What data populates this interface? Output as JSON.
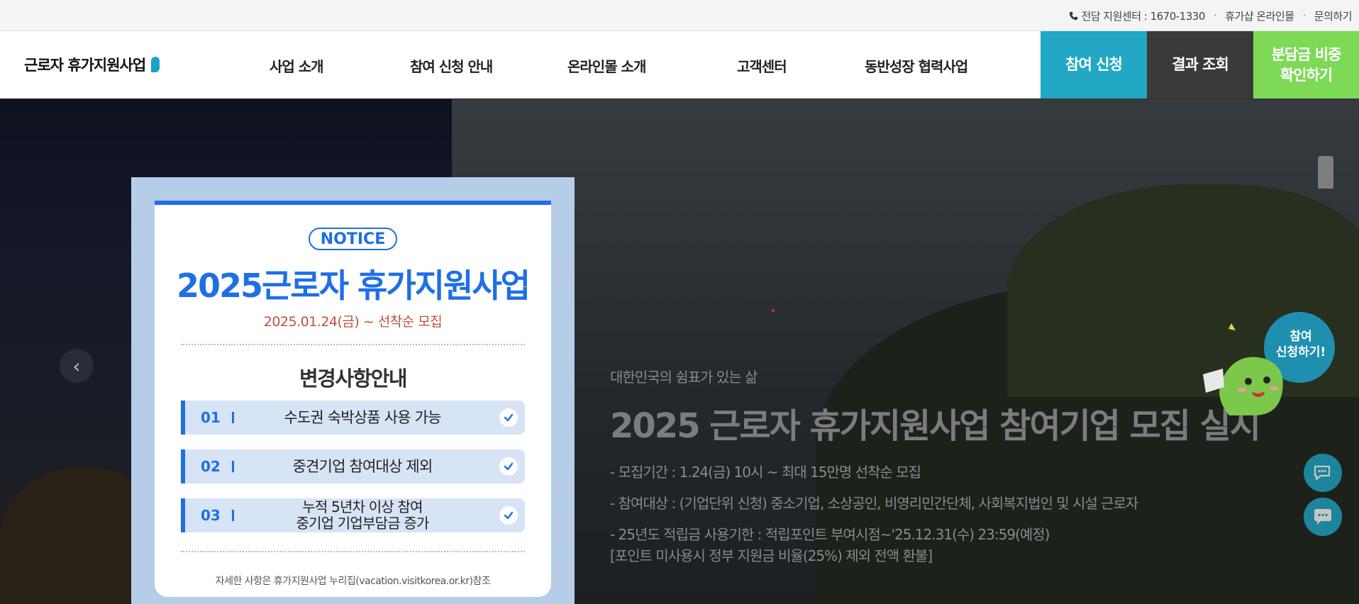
{
  "topbar": {
    "phone": "전담 지원센터 : 1670-1330",
    "mall": "휴가샵 온라인몰",
    "inquiry": "문의하기"
  },
  "header": {
    "logo": "근로자 휴가지원사업",
    "nav": [
      "사업 소개",
      "참여 신청 안내",
      "온라인몰 소개",
      "고객센터",
      "동반성장 협력사업"
    ],
    "apply": "참여 신청",
    "result": "결과 조회",
    "check_line1": "분담금 비중",
    "check_line2": "확인하기"
  },
  "hero": {
    "sub": "대한민국의 쉼표가 있는 삶",
    "title": "2025 근로자 휴가지원사업 참여기업 모집 실시",
    "lines": [
      "- 모집기간 : 1.24(금) 10시 ~ 최대 15만명 선착순 모집",
      "- 참여대상 : (기업단위 신청) 중소기업, 소상공인, 비영리민간단체, 사회복지법인 및 시설 근로자",
      "- 25년도 적립금 사용기한 : 적립포인트 부여시점~'25.12.31(수) 23:59(예정)",
      "[포인트 미사용시 정부 지원금 비율(25%) 제외 전액 환불]"
    ]
  },
  "popup": {
    "notice": "NOTICE",
    "title": "2025근로자 휴가지원사업",
    "date": "2025.01.24(금) ~ 선착순 모집",
    "heading": "변경사항안내",
    "items": [
      {
        "num": "01",
        "text": "수도권 숙박상품 사용 가능"
      },
      {
        "num": "02",
        "text": "중견기업 참여대상 제외"
      },
      {
        "num": "03",
        "text_line1": "누적 5년차 이상 참여",
        "text_line2": "중기업 기업부담금 증가"
      }
    ],
    "footer": "자세한 사항은 휴가지원사업 누리집(vacation.visitkorea.or.kr)참조"
  },
  "mascot": {
    "bubble_line1": "참여",
    "bubble_line2": "신청하기!"
  },
  "colors": {
    "accent_blue": "#1f6fe6",
    "apply_teal": "#22a8c4",
    "result_dark": "#3a3a3a",
    "check_green": "#7ed957",
    "date_red": "#c0503a"
  },
  "icons": [
    "phone-icon",
    "chevron-left-icon",
    "check-icon",
    "chat-icon",
    "message-icon"
  ]
}
